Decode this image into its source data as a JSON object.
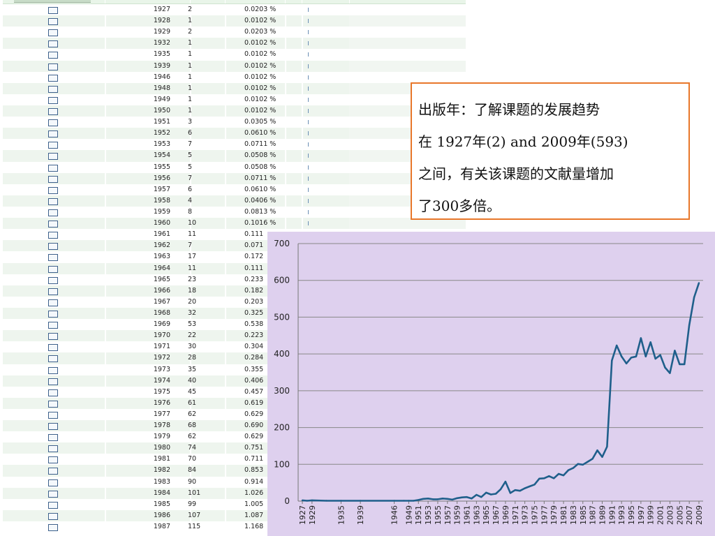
{
  "table": {
    "rows": [
      {
        "year": "1927",
        "count": "2",
        "percent": "0.0203 %",
        "bar": true
      },
      {
        "year": "1928",
        "count": "1",
        "percent": "0.0102 %",
        "bar": true
      },
      {
        "year": "1929",
        "count": "2",
        "percent": "0.0203 %",
        "bar": true
      },
      {
        "year": "1932",
        "count": "1",
        "percent": "0.0102 %",
        "bar": true
      },
      {
        "year": "1935",
        "count": "1",
        "percent": "0.0102 %",
        "bar": true
      },
      {
        "year": "1939",
        "count": "1",
        "percent": "0.0102 %",
        "bar": true
      },
      {
        "year": "1946",
        "count": "1",
        "percent": "0.0102 %",
        "bar": true
      },
      {
        "year": "1948",
        "count": "1",
        "percent": "0.0102 %",
        "bar": true
      },
      {
        "year": "1949",
        "count": "1",
        "percent": "0.0102 %",
        "bar": true
      },
      {
        "year": "1950",
        "count": "1",
        "percent": "0.0102 %",
        "bar": true
      },
      {
        "year": "1951",
        "count": "3",
        "percent": "0.0305 %",
        "bar": true
      },
      {
        "year": "1952",
        "count": "6",
        "percent": "0.0610 %",
        "bar": true
      },
      {
        "year": "1953",
        "count": "7",
        "percent": "0.0711 %",
        "bar": true
      },
      {
        "year": "1954",
        "count": "5",
        "percent": "0.0508 %",
        "bar": true
      },
      {
        "year": "1955",
        "count": "5",
        "percent": "0.0508 %",
        "bar": true
      },
      {
        "year": "1956",
        "count": "7",
        "percent": "0.0711 %",
        "bar": true
      },
      {
        "year": "1957",
        "count": "6",
        "percent": "0.0610 %",
        "bar": true
      },
      {
        "year": "1958",
        "count": "4",
        "percent": "0.0406 %",
        "bar": true
      },
      {
        "year": "1959",
        "count": "8",
        "percent": "0.0813 %",
        "bar": true
      },
      {
        "year": "1960",
        "count": "10",
        "percent": "0.1016 %",
        "bar": true
      },
      {
        "year": "1961",
        "count": "11",
        "percent": "0.111",
        "bar": false
      },
      {
        "year": "1962",
        "count": "7",
        "percent": "0.071",
        "bar": false
      },
      {
        "year": "1963",
        "count": "17",
        "percent": "0.172",
        "bar": false
      },
      {
        "year": "1964",
        "count": "11",
        "percent": "0.111",
        "bar": false
      },
      {
        "year": "1965",
        "count": "23",
        "percent": "0.233",
        "bar": false
      },
      {
        "year": "1966",
        "count": "18",
        "percent": "0.182",
        "bar": false
      },
      {
        "year": "1967",
        "count": "20",
        "percent": "0.203",
        "bar": false
      },
      {
        "year": "1968",
        "count": "32",
        "percent": "0.325",
        "bar": false
      },
      {
        "year": "1969",
        "count": "53",
        "percent": "0.538",
        "bar": false
      },
      {
        "year": "1970",
        "count": "22",
        "percent": "0.223",
        "bar": false
      },
      {
        "year": "1971",
        "count": "30",
        "percent": "0.304",
        "bar": false
      },
      {
        "year": "1972",
        "count": "28",
        "percent": "0.284",
        "bar": false
      },
      {
        "year": "1973",
        "count": "35",
        "percent": "0.355",
        "bar": false
      },
      {
        "year": "1974",
        "count": "40",
        "percent": "0.406",
        "bar": false
      },
      {
        "year": "1975",
        "count": "45",
        "percent": "0.457",
        "bar": false
      },
      {
        "year": "1976",
        "count": "61",
        "percent": "0.619",
        "bar": false
      },
      {
        "year": "1977",
        "count": "62",
        "percent": "0.629",
        "bar": false
      },
      {
        "year": "1978",
        "count": "68",
        "percent": "0.690",
        "bar": false
      },
      {
        "year": "1979",
        "count": "62",
        "percent": "0.629",
        "bar": false
      },
      {
        "year": "1980",
        "count": "74",
        "percent": "0.751",
        "bar": false
      },
      {
        "year": "1981",
        "count": "70",
        "percent": "0.711",
        "bar": false
      },
      {
        "year": "1982",
        "count": "84",
        "percent": "0.853",
        "bar": false
      },
      {
        "year": "1983",
        "count": "90",
        "percent": "0.914",
        "bar": false
      },
      {
        "year": "1984",
        "count": "101",
        "percent": "1.026",
        "bar": false
      },
      {
        "year": "1985",
        "count": "99",
        "percent": "1.005",
        "bar": false
      },
      {
        "year": "1986",
        "count": "107",
        "percent": "1.087",
        "bar": false
      },
      {
        "year": "1987",
        "count": "115",
        "percent": "1.168",
        "bar": false
      }
    ]
  },
  "callout": {
    "line1": "出版年：了解课题的发展趋势",
    "line2": "在 1927年(2) and 2009年(593)",
    "line3": "之间，有关该课题的文献量增加",
    "line4": "了300多倍。"
  },
  "chart_data": {
    "type": "line",
    "title": "",
    "xlabel": "",
    "ylabel": "",
    "ylim": [
      0,
      700
    ],
    "yticks": [
      "0",
      "100",
      "200",
      "300",
      "400",
      "500",
      "600",
      "700"
    ],
    "xticks": [
      "1927",
      "1929",
      "1935",
      "1939",
      "1946",
      "1949",
      "1951",
      "1953",
      "1955",
      "1957",
      "1959",
      "1961",
      "1963",
      "1965",
      "1967",
      "1969",
      "1971",
      "1973",
      "1975",
      "1977",
      "1979",
      "1981",
      "1983",
      "1985",
      "1987",
      "1989",
      "1991",
      "1993",
      "1995",
      "1997",
      "1999",
      "2001",
      "2003",
      "2005",
      "2007",
      "2009"
    ],
    "grid": true,
    "legend": "none",
    "line_color": "#1f5f8b",
    "x": [
      "1927",
      "1928",
      "1929",
      "1932",
      "1935",
      "1939",
      "1946",
      "1948",
      "1949",
      "1950",
      "1951",
      "1952",
      "1953",
      "1954",
      "1955",
      "1956",
      "1957",
      "1958",
      "1959",
      "1960",
      "1961",
      "1962",
      "1963",
      "1964",
      "1965",
      "1966",
      "1967",
      "1968",
      "1969",
      "1970",
      "1971",
      "1972",
      "1973",
      "1974",
      "1975",
      "1976",
      "1977",
      "1978",
      "1979",
      "1980",
      "1981",
      "1982",
      "1983",
      "1984",
      "1985",
      "1986",
      "1987",
      "1988",
      "1989",
      "1990",
      "1991",
      "1992",
      "1993",
      "1994",
      "1995",
      "1996",
      "1997",
      "1998",
      "1999",
      "2000",
      "2001",
      "2002",
      "2003",
      "2004",
      "2005",
      "2006",
      "2007",
      "2008",
      "2009"
    ],
    "values": [
      2,
      1,
      2,
      1,
      1,
      1,
      1,
      1,
      1,
      1,
      3,
      6,
      7,
      5,
      5,
      7,
      6,
      4,
      8,
      10,
      11,
      7,
      17,
      11,
      23,
      18,
      20,
      32,
      53,
      22,
      30,
      28,
      35,
      40,
      45,
      61,
      62,
      68,
      62,
      74,
      70,
      84,
      90,
      101,
      99,
      107,
      115,
      138,
      120,
      148,
      382,
      423,
      393,
      374,
      390,
      393,
      443,
      393,
      432,
      387,
      397,
      363,
      348,
      409,
      372,
      372,
      478,
      554,
      593
    ]
  }
}
